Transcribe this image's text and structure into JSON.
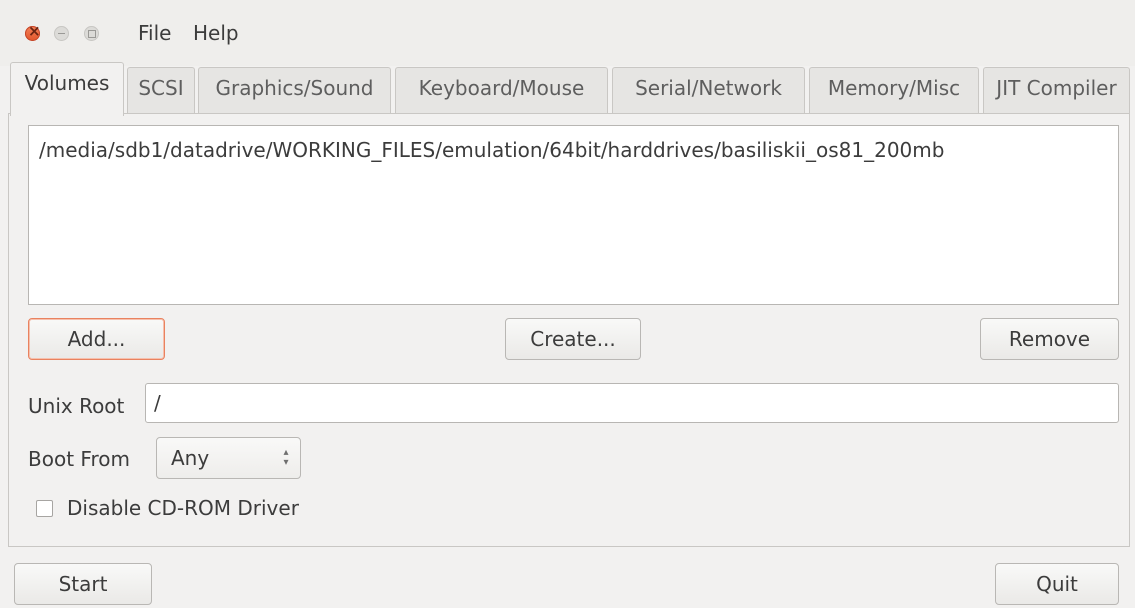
{
  "menubar": {
    "items": [
      "File",
      "Help"
    ]
  },
  "tabs": [
    "Volumes",
    "SCSI",
    "Graphics/Sound",
    "Keyboard/Mouse",
    "Serial/Network",
    "Memory/Misc",
    "JIT Compiler"
  ],
  "active_tab": "Volumes",
  "volumes": {
    "list": [
      "/media/sdb1/datadrive/WORKING_FILES/emulation/64bit/harddrives/basiliskii_os81_200mb"
    ],
    "add_label": "Add...",
    "create_label": "Create...",
    "remove_label": "Remove"
  },
  "unix_root": {
    "label": "Unix Root",
    "value": "/"
  },
  "boot_from": {
    "label": "Boot From",
    "value": "Any"
  },
  "disable_cdrom": {
    "label": "Disable CD-ROM Driver",
    "checked": false
  },
  "footer": {
    "start_label": "Start",
    "quit_label": "Quit"
  },
  "colors": {
    "close_button": "#e2552b",
    "focus_border": "#e9825f",
    "window_bg": "#f2f1f0"
  }
}
